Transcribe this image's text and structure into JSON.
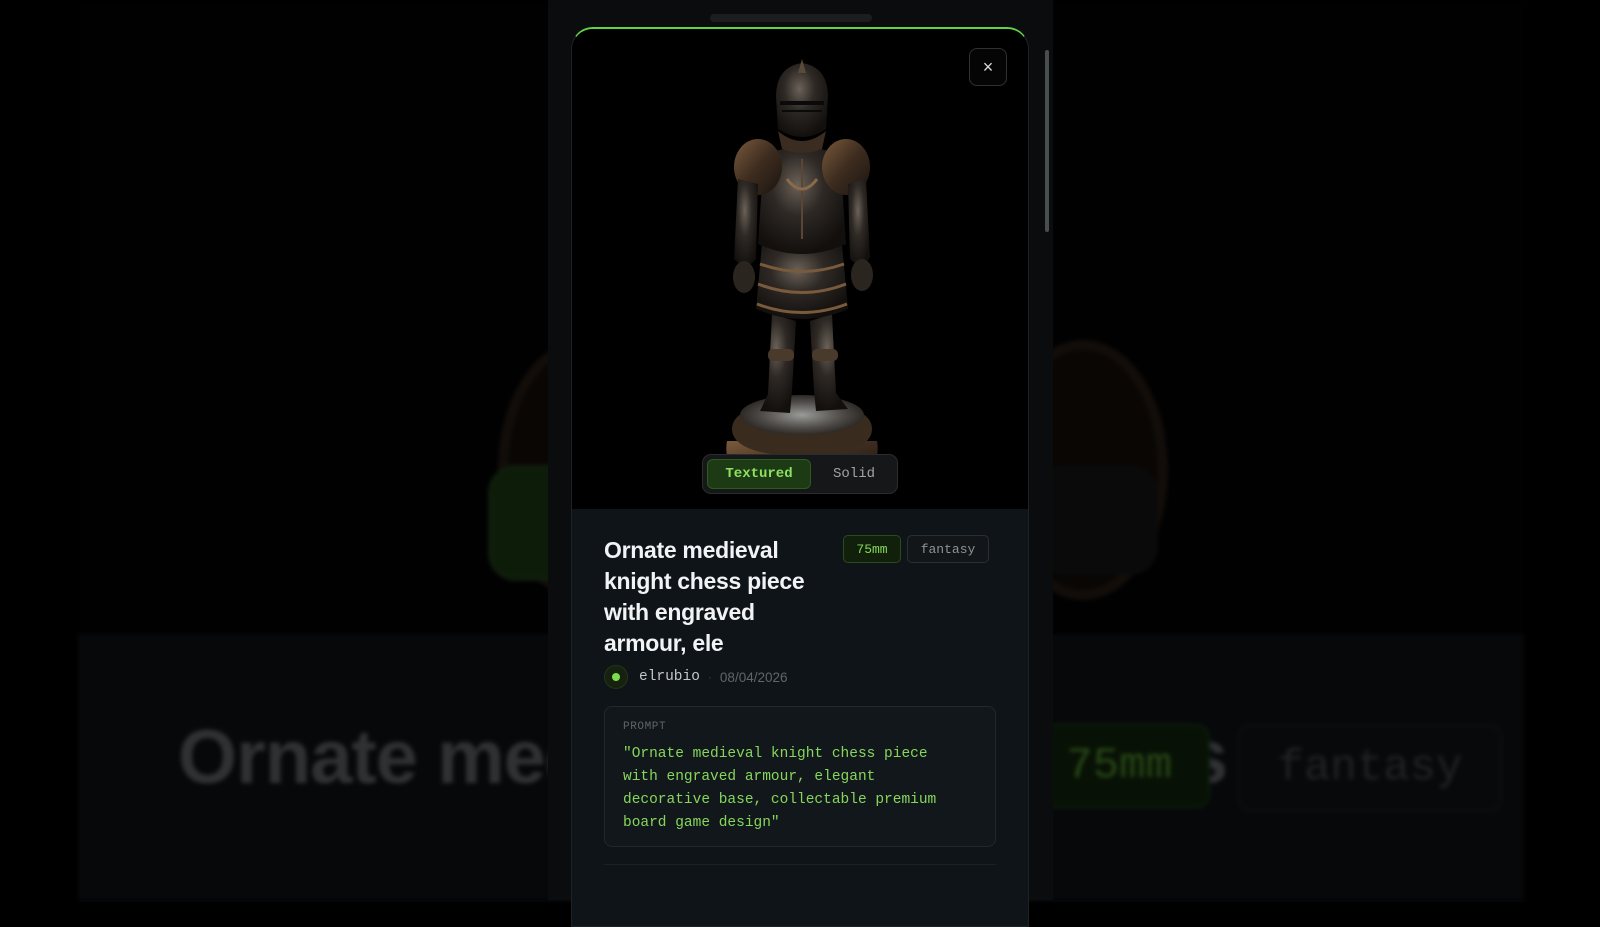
{
  "background": {
    "title_text": "Ornate medieval knight chess piece",
    "size_tag": "75mm",
    "genre_tag": "fantasy"
  },
  "modal": {
    "close_label": "×",
    "viewer": {
      "subject": "knight-figure",
      "view_modes": [
        "Textured",
        "Solid"
      ],
      "active_mode": "Textured"
    },
    "title": "Ornate medieval knight chess piece with engraved armour, ele",
    "tags": {
      "size": "75mm",
      "genre": "fantasy"
    },
    "author": {
      "name": "elrubio",
      "separator": "·",
      "date": "08/04/2026"
    },
    "prompt": {
      "label": "PROMPT",
      "text": "\"Ornate medieval knight chess piece with engraved armour, elegant decorative base, collectable premium board game design\""
    }
  },
  "colors": {
    "accent": "#86d65c",
    "accent_border": "#62d344",
    "modal_bg": "#0f1418",
    "viewer_bg": "#000000"
  }
}
